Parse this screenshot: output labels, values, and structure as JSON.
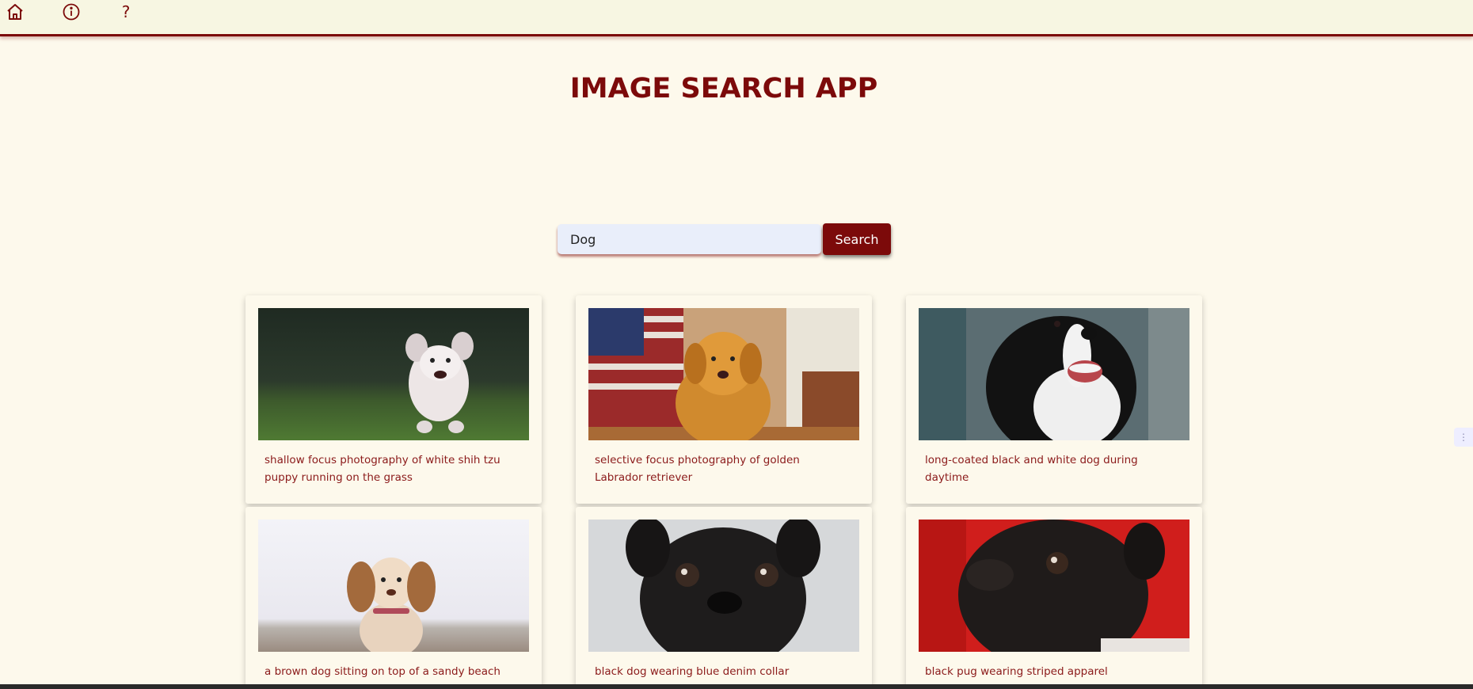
{
  "nav": {
    "home_icon": "home-icon",
    "info_icon": "info-icon",
    "help_label": "?"
  },
  "title": "IMAGE SEARCH APP",
  "search": {
    "value": "Dog",
    "button_label": "Search"
  },
  "results": [
    {
      "caption": "shallow focus photography of white shih tzu puppy running on the grass"
    },
    {
      "caption": "selective focus photography of golden Labrador retriever"
    },
    {
      "caption": "long-coated black and white dog during daytime"
    },
    {
      "caption": "a brown dog sitting on top of a sandy beach"
    },
    {
      "caption": "black dog wearing blue denim collar"
    },
    {
      "caption": "black pug wearing striped apparel"
    }
  ],
  "colors": {
    "accent": "#7c0a0a",
    "background": "#fdf9ec",
    "topbar": "#f7f6e2",
    "input": "#e9eefa"
  }
}
